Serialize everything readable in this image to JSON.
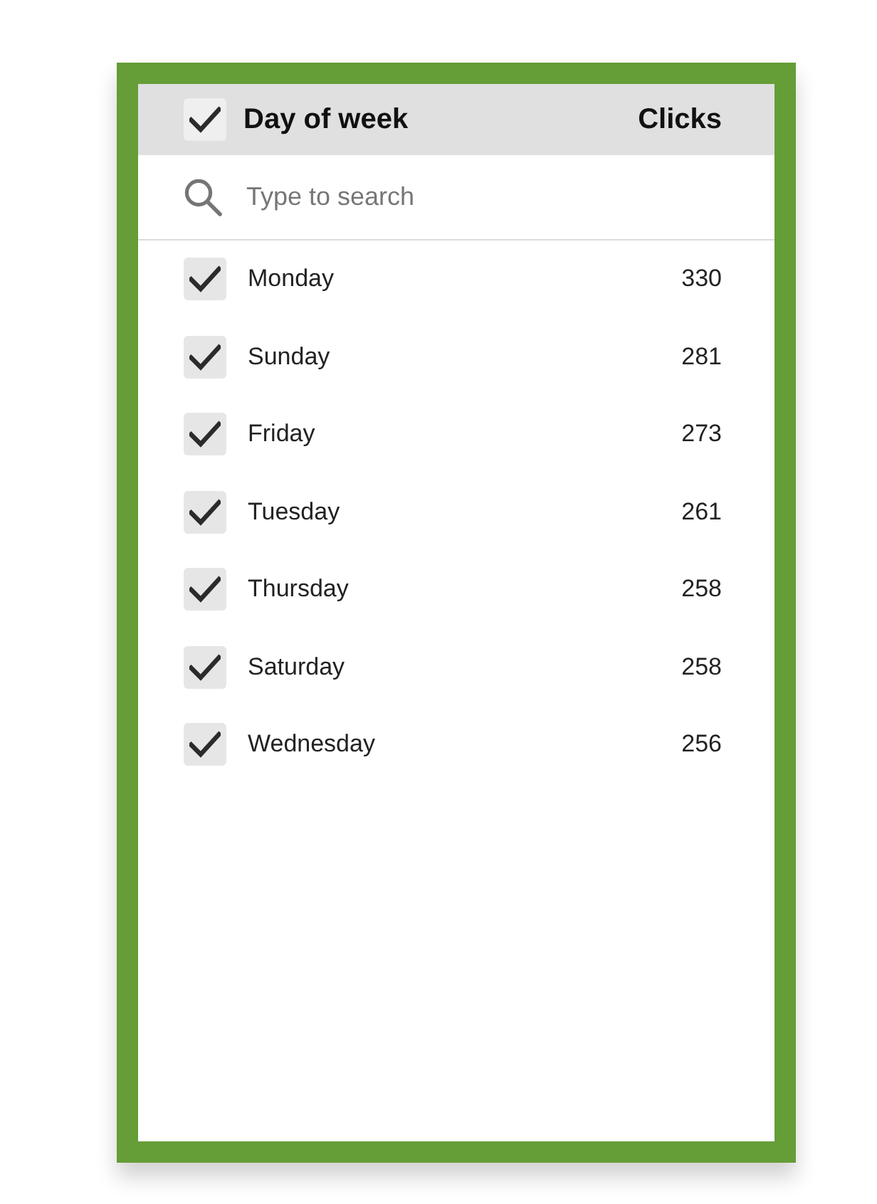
{
  "header": {
    "checked": true,
    "label": "Day of week",
    "metric": "Clicks"
  },
  "search": {
    "placeholder": "Type to search"
  },
  "items": [
    {
      "label": "Monday",
      "value": "330",
      "checked": true
    },
    {
      "label": "Sunday",
      "value": "281",
      "checked": true
    },
    {
      "label": "Friday",
      "value": "273",
      "checked": true
    },
    {
      "label": "Tuesday",
      "value": "261",
      "checked": true
    },
    {
      "label": "Thursday",
      "value": "258",
      "checked": true
    },
    {
      "label": "Saturday",
      "value": "258",
      "checked": true
    },
    {
      "label": "Wednesday",
      "value": "256",
      "checked": true
    }
  ]
}
